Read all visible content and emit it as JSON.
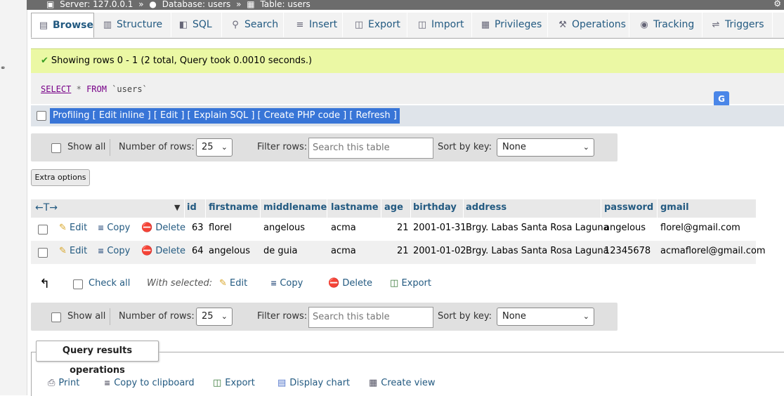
{
  "breadcrumb": {
    "server": "Server: 127.0.0.1",
    "database": "Database: users",
    "table": "Table: users",
    "separator": "»"
  },
  "tabs": [
    {
      "label": "Browse",
      "icon": "browse-icon",
      "active": true
    },
    {
      "label": "Structure",
      "icon": "structure-icon"
    },
    {
      "label": "SQL",
      "icon": "sql-icon"
    },
    {
      "label": "Search",
      "icon": "search-icon"
    },
    {
      "label": "Insert",
      "icon": "insert-icon"
    },
    {
      "label": "Export",
      "icon": "export-icon"
    },
    {
      "label": "Import",
      "icon": "import-icon"
    },
    {
      "label": "Privileges",
      "icon": "privileges-icon"
    },
    {
      "label": "Operations",
      "icon": "operations-icon"
    },
    {
      "label": "Tracking",
      "icon": "tracking-icon"
    },
    {
      "label": "Triggers",
      "icon": "triggers-icon"
    }
  ],
  "status": {
    "message": "Showing rows 0 - 1 (2 total, Query took 0.0010 seconds.)"
  },
  "query": {
    "select": "SELECT",
    "star": "*",
    "from": "FROM",
    "table": "`users`"
  },
  "profiling": {
    "links": "Profiling [ Edit inline ] [ Edit ] [ Explain SQL ] [ Create PHP code ] [ Refresh ]"
  },
  "navigation": {
    "show_all": "Show all",
    "number_of_rows_label": "Number of rows:",
    "number_of_rows_value": "25",
    "filter_label": "Filter rows:",
    "filter_placeholder": "Search this table",
    "sort_label": "Sort by key:",
    "sort_value": "None"
  },
  "extra_options": "Extra options",
  "table": {
    "columns": [
      "id",
      "firstname",
      "middlename",
      "lastname",
      "age",
      "birthday",
      "address",
      "password",
      "gmail"
    ],
    "actions": {
      "edit": "Edit",
      "copy": "Copy",
      "delete": "Delete"
    },
    "rows": [
      {
        "id": "63",
        "firstname": "florel",
        "middlename": "angelous",
        "lastname": "acma",
        "age": "21",
        "birthday": "2001-01-31",
        "address": "Brgy. Labas Santa Rosa Laguna",
        "password": "angelous",
        "gmail": "florel@gmail.com"
      },
      {
        "id": "64",
        "firstname": "angelous",
        "middlename": "de guia",
        "lastname": "acma",
        "age": "21",
        "birthday": "2001-01-02",
        "address": "Brgy. Labas Santa Rosa Laguna",
        "password": "12345678",
        "gmail": "acmaflorel@gmail.com"
      }
    ]
  },
  "bulk": {
    "check_all": "Check all",
    "with_selected": "With selected:",
    "edit": "Edit",
    "copy": "Copy",
    "delete": "Delete",
    "export": "Export"
  },
  "query_results_ops": {
    "title": "Query results operations",
    "print": "Print",
    "copy_clipboard": "Copy to clipboard",
    "export": "Export",
    "display_chart": "Display chart",
    "create_view": "Create view"
  }
}
